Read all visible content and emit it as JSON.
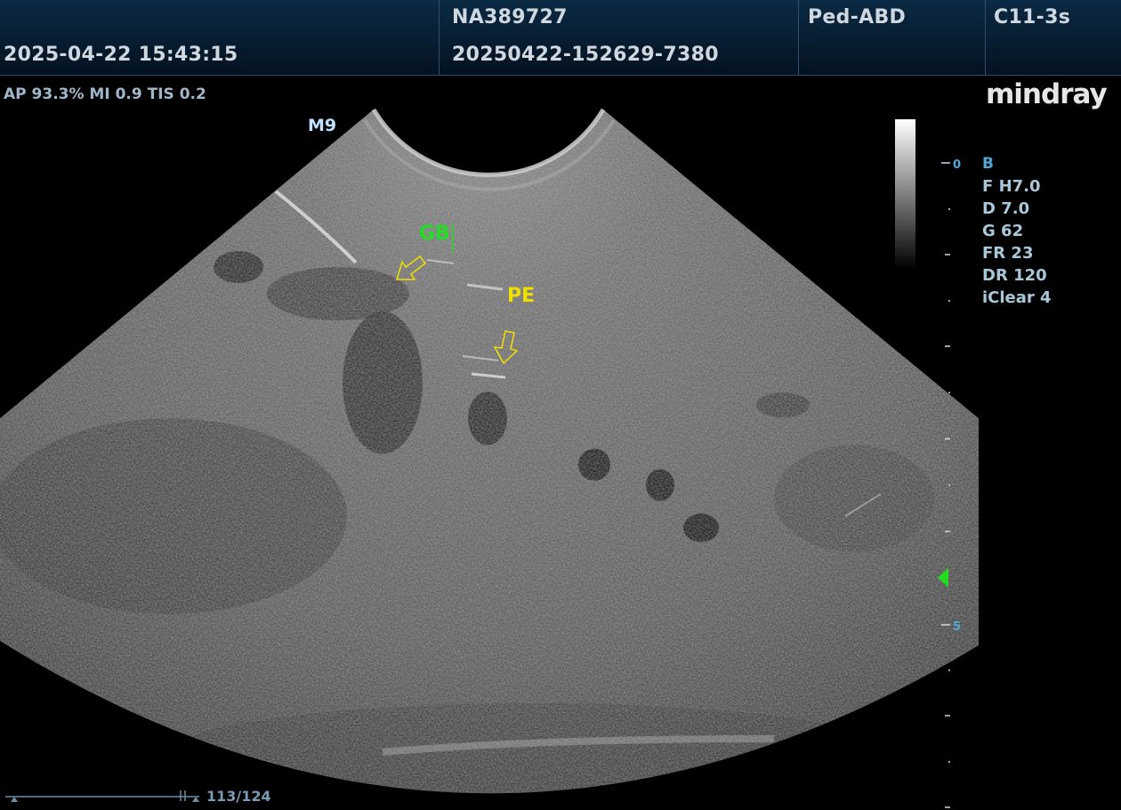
{
  "header": {
    "datetime": "2025-04-22 15:43:15",
    "patient_id": "NA389727",
    "exam_id": "20250422-152629-7380",
    "preset": "Ped-ABD",
    "probe": "C11-3s"
  },
  "acoustic": {
    "text": "AP 93.3%  MI 0.9 TIS 0.2"
  },
  "logo": "mindray",
  "probe_mark": "M9",
  "annotations": {
    "gb": "GB",
    "pe": "PE"
  },
  "depth_scale": {
    "top": "0",
    "mid": "5"
  },
  "params": {
    "mode": "B",
    "freq": "F H7.0",
    "depth": "D 7.0",
    "gain": "G 62",
    "frame_rate": "FR 23",
    "dynamic_range": "DR 120",
    "iclear": "iClear 4"
  },
  "cine": {
    "count": "113/124",
    "progress": 0.911
  },
  "colors": {
    "gb_label": "#22dd22",
    "pe_label": "#f0e000",
    "focus_marker": "#22dd22"
  }
}
